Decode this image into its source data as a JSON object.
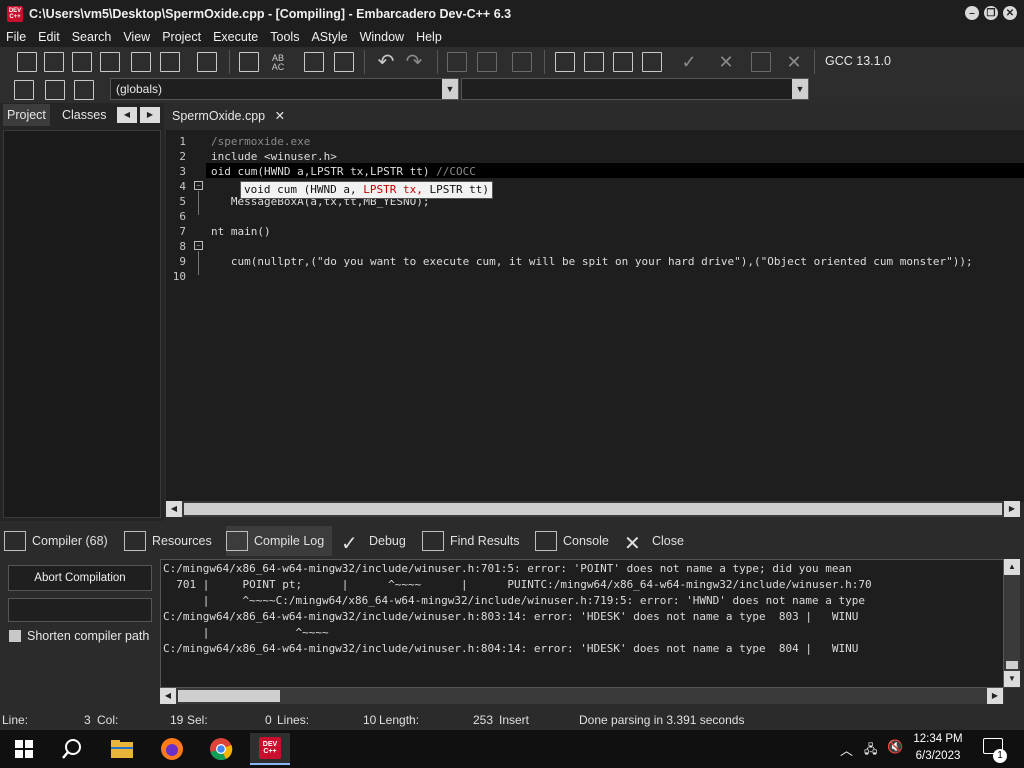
{
  "window": {
    "title": "C:\\Users\\vm5\\Desktop\\SpermOxide.cpp - [Compiling] - Embarcadero Dev-C++ 6.3",
    "app_icon_text": "DEV C++"
  },
  "menu": [
    "File",
    "Edit",
    "Search",
    "View",
    "Project",
    "Execute",
    "Tools",
    "AStyle",
    "Window",
    "Help"
  ],
  "toolbar": {
    "compiler_label": "GCC 13.1.0",
    "scope_combo": "(globals)",
    "rename_icon_text": "AB AC"
  },
  "left_tabs": [
    "Project",
    "Classes"
  ],
  "editor": {
    "tab_label": "SpermOxide.cpp",
    "close_glyph": "✕",
    "lines": [
      {
        "n": "1",
        "text": "/spermoxide.exe",
        "cls": "comment"
      },
      {
        "n": "2",
        "text": "include <winuser.h>",
        "cls": ""
      },
      {
        "n": "3",
        "text": "oid cum(HWND a,LPSTR tx,LPSTR tt) ",
        "comment": "//COCC"
      },
      {
        "n": "4",
        "text": "",
        "cls": ""
      },
      {
        "n": "5",
        "text": "   MessageBoxA(a,tx,tt,MB_YESNO);",
        "cls": ""
      },
      {
        "n": "6",
        "text": "",
        "cls": ""
      },
      {
        "n": "7",
        "text": "nt main()",
        "cls": ""
      },
      {
        "n": "8",
        "text": "",
        "cls": ""
      },
      {
        "n": "9",
        "text": "   cum(nullptr,(\"do you want to execute cum, it will be spit on your hard drive\"),(\"Object oriented cum monster\"));",
        "cls": ""
      },
      {
        "n": "10",
        "text": "",
        "cls": ""
      }
    ],
    "hint": {
      "prefix": "void cum (HWND a, ",
      "highlight": "LPSTR tx,",
      "suffix": " LPSTR tt)"
    }
  },
  "bottom_tabs": [
    {
      "label": "Compiler (68)",
      "icon": "grid-icon"
    },
    {
      "label": "Resources",
      "icon": "resources-icon"
    },
    {
      "label": "Compile Log",
      "icon": "chart-icon"
    },
    {
      "label": "Debug",
      "icon": "check-icon"
    },
    {
      "label": "Find Results",
      "icon": "find-icon"
    },
    {
      "label": "Console",
      "icon": "console-icon"
    },
    {
      "label": "Close",
      "icon": "close-icon"
    }
  ],
  "compile_panel": {
    "abort_label": "Abort Compilation",
    "shorten_label": "Shorten compiler path"
  },
  "log_lines": [
    "C:/mingw64/x86_64-w64-mingw32/include/winuser.h:701:5: error: 'POINT' does not name a type; did you mean",
    "  701 |     POINT pt;      |      ^~~~~      |      PUINTC:/mingw64/x86_64-w64-mingw32/include/winuser.h:70",
    "      |     ^~~~~C:/mingw64/x86_64-w64-mingw32/include/winuser.h:719:5: error: 'HWND' does not name a type",
    "C:/mingw64/x86_64-w64-mingw32/include/winuser.h:803:14: error: 'HDESK' does not name a type  803 |   WINU",
    "      |             ^~~~~",
    "C:/mingw64/x86_64-w64-mingw32/include/winuser.h:804:14: error: 'HDESK' does not name a type  804 |   WINU"
  ],
  "status": {
    "line_label": "Line:",
    "line_val": "3",
    "col_label": "Col:",
    "col_val": "19",
    "sel_label": "Sel:",
    "sel_val": "0",
    "lines_label": "Lines:",
    "lines_val": "10",
    "length_label": "Length:",
    "length_val": "253",
    "mode": "Insert",
    "message": "Done parsing in 3.391 seconds"
  },
  "taskbar": {
    "time": "12:34 PM",
    "date": "6/3/2023",
    "notif_count": "1",
    "devcpp_text": "DEV C++"
  }
}
